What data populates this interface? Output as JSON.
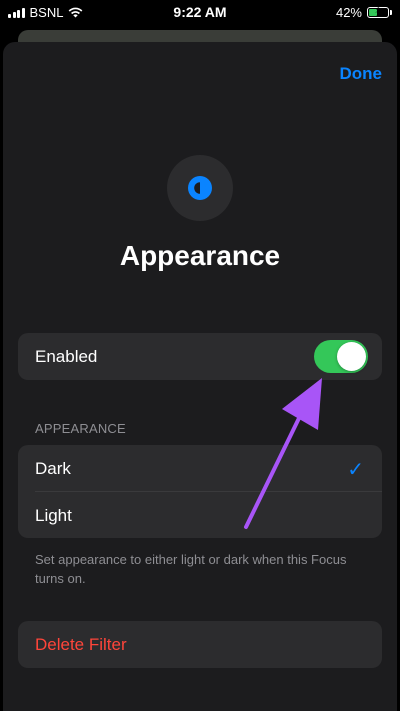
{
  "status_bar": {
    "carrier": "BSNL",
    "time": "9:22 AM",
    "battery": "42%"
  },
  "header": {
    "done_label": "Done"
  },
  "focus_filter": {
    "icon": "appearance-half-circle-icon",
    "title": "Appearance"
  },
  "enabled_row": {
    "label": "Enabled",
    "toggle_on": true
  },
  "appearance_section": {
    "header": "APPEARANCE",
    "options": [
      {
        "label": "Dark",
        "selected": true
      },
      {
        "label": "Light",
        "selected": false
      }
    ],
    "footer": "Set appearance to either light or dark when this Focus turns on."
  },
  "delete_label": "Delete Filter",
  "colors": {
    "accent": "#0a84ff",
    "toggle_on": "#34c759",
    "destructive": "#ff453a",
    "annotation_arrow": "#a855f7"
  }
}
